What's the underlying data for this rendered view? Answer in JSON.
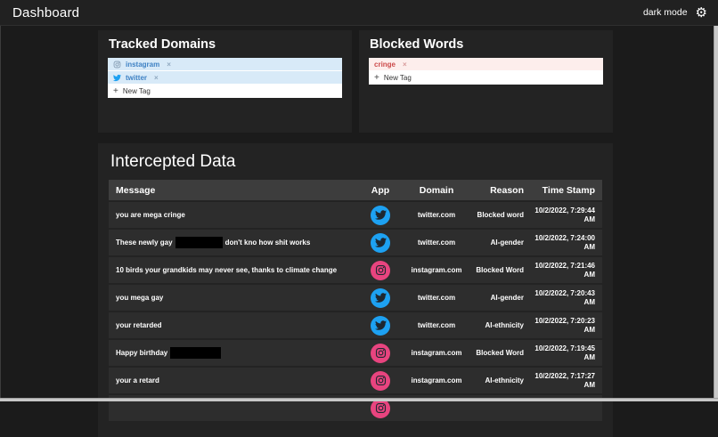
{
  "header": {
    "title": "Dashboard",
    "dark_mode_label": "dark mode",
    "settings_icon": "gear-icon"
  },
  "panels": {
    "tracked_domains": {
      "title": "Tracked Domains",
      "tags": [
        {
          "label": "instagram",
          "icon": "instagram-icon",
          "remove": "×"
        },
        {
          "label": "twitter",
          "icon": "twitter-icon",
          "remove": "×"
        }
      ],
      "new_tag": {
        "plus": "+",
        "label": "New Tag"
      }
    },
    "blocked_words": {
      "title": "Blocked Words",
      "tags": [
        {
          "label": "cringe",
          "icon": null,
          "remove": "×"
        }
      ],
      "new_tag": {
        "plus": "+",
        "label": "New Tag"
      }
    }
  },
  "intercepted": {
    "title": "Intercepted Data",
    "columns": [
      "Message",
      "App",
      "Domain",
      "Reason",
      "Time Stamp"
    ],
    "rows": [
      {
        "message": "you are mega cringe",
        "app": "twitter",
        "domain": "twitter.com",
        "reason": "Blocked word",
        "timestamp": "10/2/2022, 7:29:44 AM"
      },
      {
        "message": "These newly gay",
        "redact_width": 53,
        "message_after": "don't kno how shit works",
        "app": "twitter",
        "domain": "twitter.com",
        "reason": "AI-gender",
        "timestamp": "10/2/2022, 7:24:00 AM"
      },
      {
        "message": "10 birds your grandkids may never see, thanks to climate change",
        "app": "instagram",
        "domain": "instagram.com",
        "reason": "Blocked Word",
        "timestamp": "10/2/2022, 7:21:46 AM"
      },
      {
        "message": "you mega gay",
        "app": "twitter",
        "domain": "twitter.com",
        "reason": "AI-gender",
        "timestamp": "10/2/2022, 7:20:43 AM"
      },
      {
        "message": "your retarded",
        "app": "twitter",
        "domain": "twitter.com",
        "reason": "AI-ethnicity",
        "timestamp": "10/2/2022, 7:20:23 AM"
      },
      {
        "message": "Happy birthday",
        "redact_width": 57,
        "message_after": "",
        "app": "instagram",
        "domain": "instagram.com",
        "reason": "Blocked Word",
        "timestamp": "10/2/2022, 7:19:45 AM"
      },
      {
        "message": "your a retard",
        "app": "instagram",
        "domain": "instagram.com",
        "reason": "AI-ethnicity",
        "timestamp": "10/2/2022, 7:17:27 AM"
      },
      {
        "partial": true,
        "app": "instagram"
      }
    ]
  },
  "colors": {
    "twitter_brand": "#1da1f2",
    "instagram_brand": "#e8447f",
    "icon_glyph_dark": "#1e2730",
    "tag_blue_bg": "#d8eaf8",
    "tag_blue_text": "#3f82c4",
    "tag_pink_bg": "#fdeeec",
    "tag_pink_text": "#cc4a4a",
    "tag_instagram_icon": "#7d95ad",
    "tag_twitter_icon": "#1da1f2"
  }
}
